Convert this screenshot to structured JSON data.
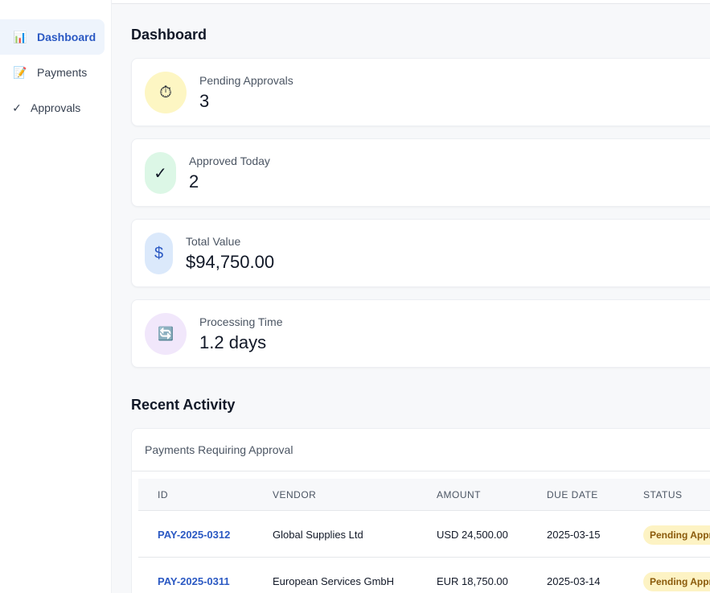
{
  "sidebar": {
    "items": [
      {
        "label": "Dashboard",
        "icon": "bar-chart-icon",
        "glyph": "📊",
        "active": true
      },
      {
        "label": "Payments",
        "icon": "memo-icon",
        "glyph": "📝",
        "active": false
      },
      {
        "label": "Approvals",
        "icon": "checkmark-icon",
        "glyph": "✓",
        "active": false
      }
    ]
  },
  "main": {
    "title": "Dashboard",
    "stats": [
      {
        "label": "Pending Approvals",
        "value": "3",
        "icon": "stopwatch-icon",
        "glyph": "⏱",
        "color": "#fdf6c3"
      },
      {
        "label": "Approved Today",
        "value": "2",
        "icon": "checkmark-icon",
        "glyph": "✓",
        "color": "#dcf7e6"
      },
      {
        "label": "Total Value",
        "value": "$94,750.00",
        "icon": "dollar-icon",
        "glyph": "$",
        "color": "#dbe9fb"
      },
      {
        "label": "Processing Time",
        "value": "1.2 days",
        "icon": "refresh-icon",
        "glyph": "🔄",
        "color": "#f1e7fb"
      }
    ],
    "recent_activity": {
      "title": "Recent Activity",
      "caption": "Payments Requiring Approval",
      "columns": [
        "ID",
        "VENDOR",
        "AMOUNT",
        "DUE DATE",
        "STATUS"
      ],
      "rows": [
        {
          "id": "PAY-2025-0312",
          "vendor": "Global Supplies Ltd",
          "amount": "USD 24,500.00",
          "due": "2025-03-15",
          "status": "Pending Approval"
        },
        {
          "id": "PAY-2025-0311",
          "vendor": "European Services GmbH",
          "amount": "EUR 18,750.00",
          "due": "2025-03-14",
          "status": "Pending Approval"
        }
      ]
    }
  }
}
